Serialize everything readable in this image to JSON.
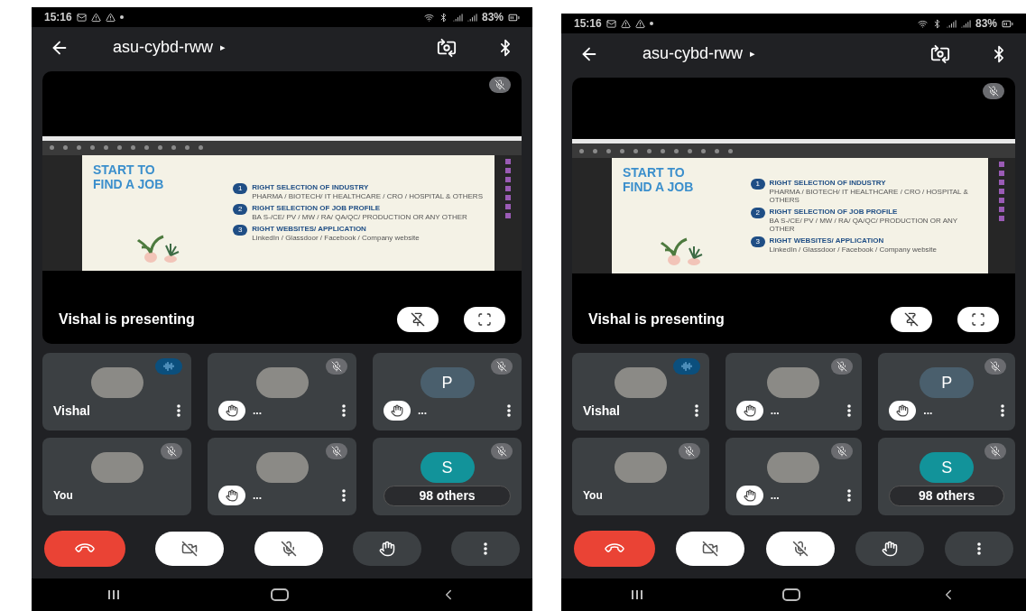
{
  "phones": [
    {
      "status_bar": {
        "time": "15:16",
        "battery": "83%"
      },
      "header": {
        "title": "asu-cybd-rww",
        "caret": "▸"
      },
      "presentation": {
        "muted": true,
        "presenter_text": "Vishal is presenting",
        "slide": {
          "title_lines": [
            "START TO",
            "FIND A JOB"
          ],
          "items": [
            {
              "number": "1",
              "heading": "RIGHT SELECTION OF INDUSTRY",
              "detail": "PHARMA / BIOTECH/ IT HEALTHCARE / CRO / HOSPITAL & OTHERS"
            },
            {
              "number": "2",
              "heading": "RIGHT SELECTION OF JOB PROFILE",
              "detail": "BA S-/CE/ PV / MW / RA/ QA/QC/ PRODUCTION OR ANY OTHER"
            },
            {
              "number": "3",
              "heading": "RIGHT WEBSITES/ APPLICATION",
              "detail": "LinkedIn / Glassdoor / Facebook / Company website"
            }
          ]
        }
      },
      "tiles": [
        {
          "kind": "participant",
          "name": "Vishal",
          "speaking": true,
          "hand_raised": false,
          "menu": true
        },
        {
          "kind": "participant",
          "name": "...",
          "speaking": false,
          "muted": true,
          "hand_raised": true,
          "menu": true
        },
        {
          "kind": "participant",
          "name": "...",
          "letter": "P",
          "color": "#4a5f6d",
          "speaking": false,
          "muted": true,
          "hand_raised": true,
          "menu": true
        },
        {
          "kind": "participant",
          "name": "You",
          "speaking": false,
          "muted": true,
          "hand_raised": false,
          "menu": false
        },
        {
          "kind": "participant",
          "name": "...",
          "speaking": false,
          "muted": true,
          "hand_raised": true,
          "menu": true
        },
        {
          "kind": "others",
          "name": "98 others",
          "letter": "S",
          "color": "#12939a",
          "speaking": false,
          "muted": true,
          "hand_raised": false,
          "menu": false
        }
      ],
      "controls": {
        "camera_on": false,
        "mic_on": false
      }
    },
    {
      "status_bar": {
        "time": "15:16",
        "battery": "83%"
      },
      "header": {
        "title": "asu-cybd-rww",
        "caret": "▸"
      },
      "presentation": {
        "muted": true,
        "presenter_text": "Vishal is presenting",
        "slide": {
          "title_lines": [
            "START TO",
            "FIND A JOB"
          ],
          "items": [
            {
              "number": "1",
              "heading": "RIGHT SELECTION OF INDUSTRY",
              "detail": "PHARMA / BIOTECH/ IT HEALTHCARE / CRO / HOSPITAL & OTHERS"
            },
            {
              "number": "2",
              "heading": "RIGHT SELECTION OF JOB PROFILE",
              "detail": "BA S-/CE/ PV / MW / RA/ QA/QC/ PRODUCTION OR ANY OTHER"
            },
            {
              "number": "3",
              "heading": "RIGHT WEBSITES/ APPLICATION",
              "detail": "LinkedIn / Glassdoor / Facebook / Company website"
            }
          ]
        }
      },
      "tiles": [
        {
          "kind": "participant",
          "name": "Vishal",
          "speaking": true,
          "hand_raised": false,
          "menu": true
        },
        {
          "kind": "participant",
          "name": "...",
          "speaking": false,
          "muted": true,
          "hand_raised": true,
          "menu": true
        },
        {
          "kind": "participant",
          "name": "...",
          "letter": "P",
          "color": "#4a5f6d",
          "speaking": false,
          "muted": true,
          "hand_raised": true,
          "menu": true
        },
        {
          "kind": "participant",
          "name": "You",
          "speaking": false,
          "muted": true,
          "hand_raised": false,
          "menu": false
        },
        {
          "kind": "participant",
          "name": "...",
          "speaking": false,
          "muted": true,
          "hand_raised": true,
          "menu": true
        },
        {
          "kind": "others",
          "name": "98 others",
          "letter": "S",
          "color": "#12939a",
          "speaking": false,
          "muted": true,
          "hand_raised": false,
          "menu": false
        }
      ],
      "controls": {
        "camera_on": false,
        "mic_on": false
      }
    }
  ]
}
